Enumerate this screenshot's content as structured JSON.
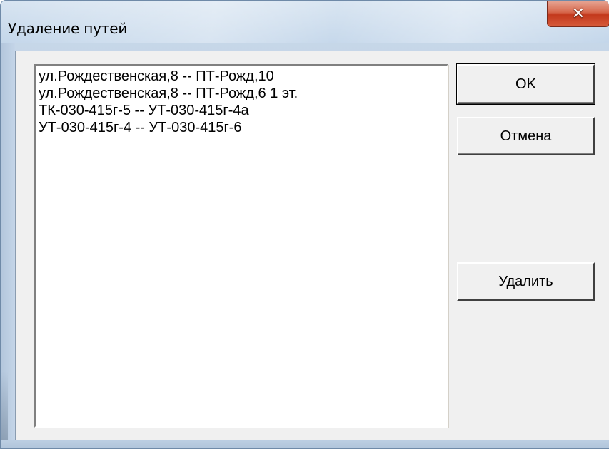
{
  "window": {
    "title": "Удаление путей"
  },
  "titlebar": {
    "close_icon": "close-icon",
    "close_glyph": "✕"
  },
  "list": {
    "items": [
      "ул.Рождественская,8 -- ПТ-Рожд,10",
      "ул.Рождественская,8 -- ПТ-Рожд,6 1 эт.",
      "ТК-030-415г-5 -- УТ-030-415г-4а",
      "УТ-030-415г-4 -- УТ-030-415г-6"
    ]
  },
  "buttons": {
    "ok_label": "OK",
    "cancel_label": "Отмена",
    "delete_label": "Удалить"
  },
  "colors": {
    "close_button": "#c3381c",
    "dialog_background": "#f0f0f0",
    "titlebar": "#c3d6ea"
  }
}
